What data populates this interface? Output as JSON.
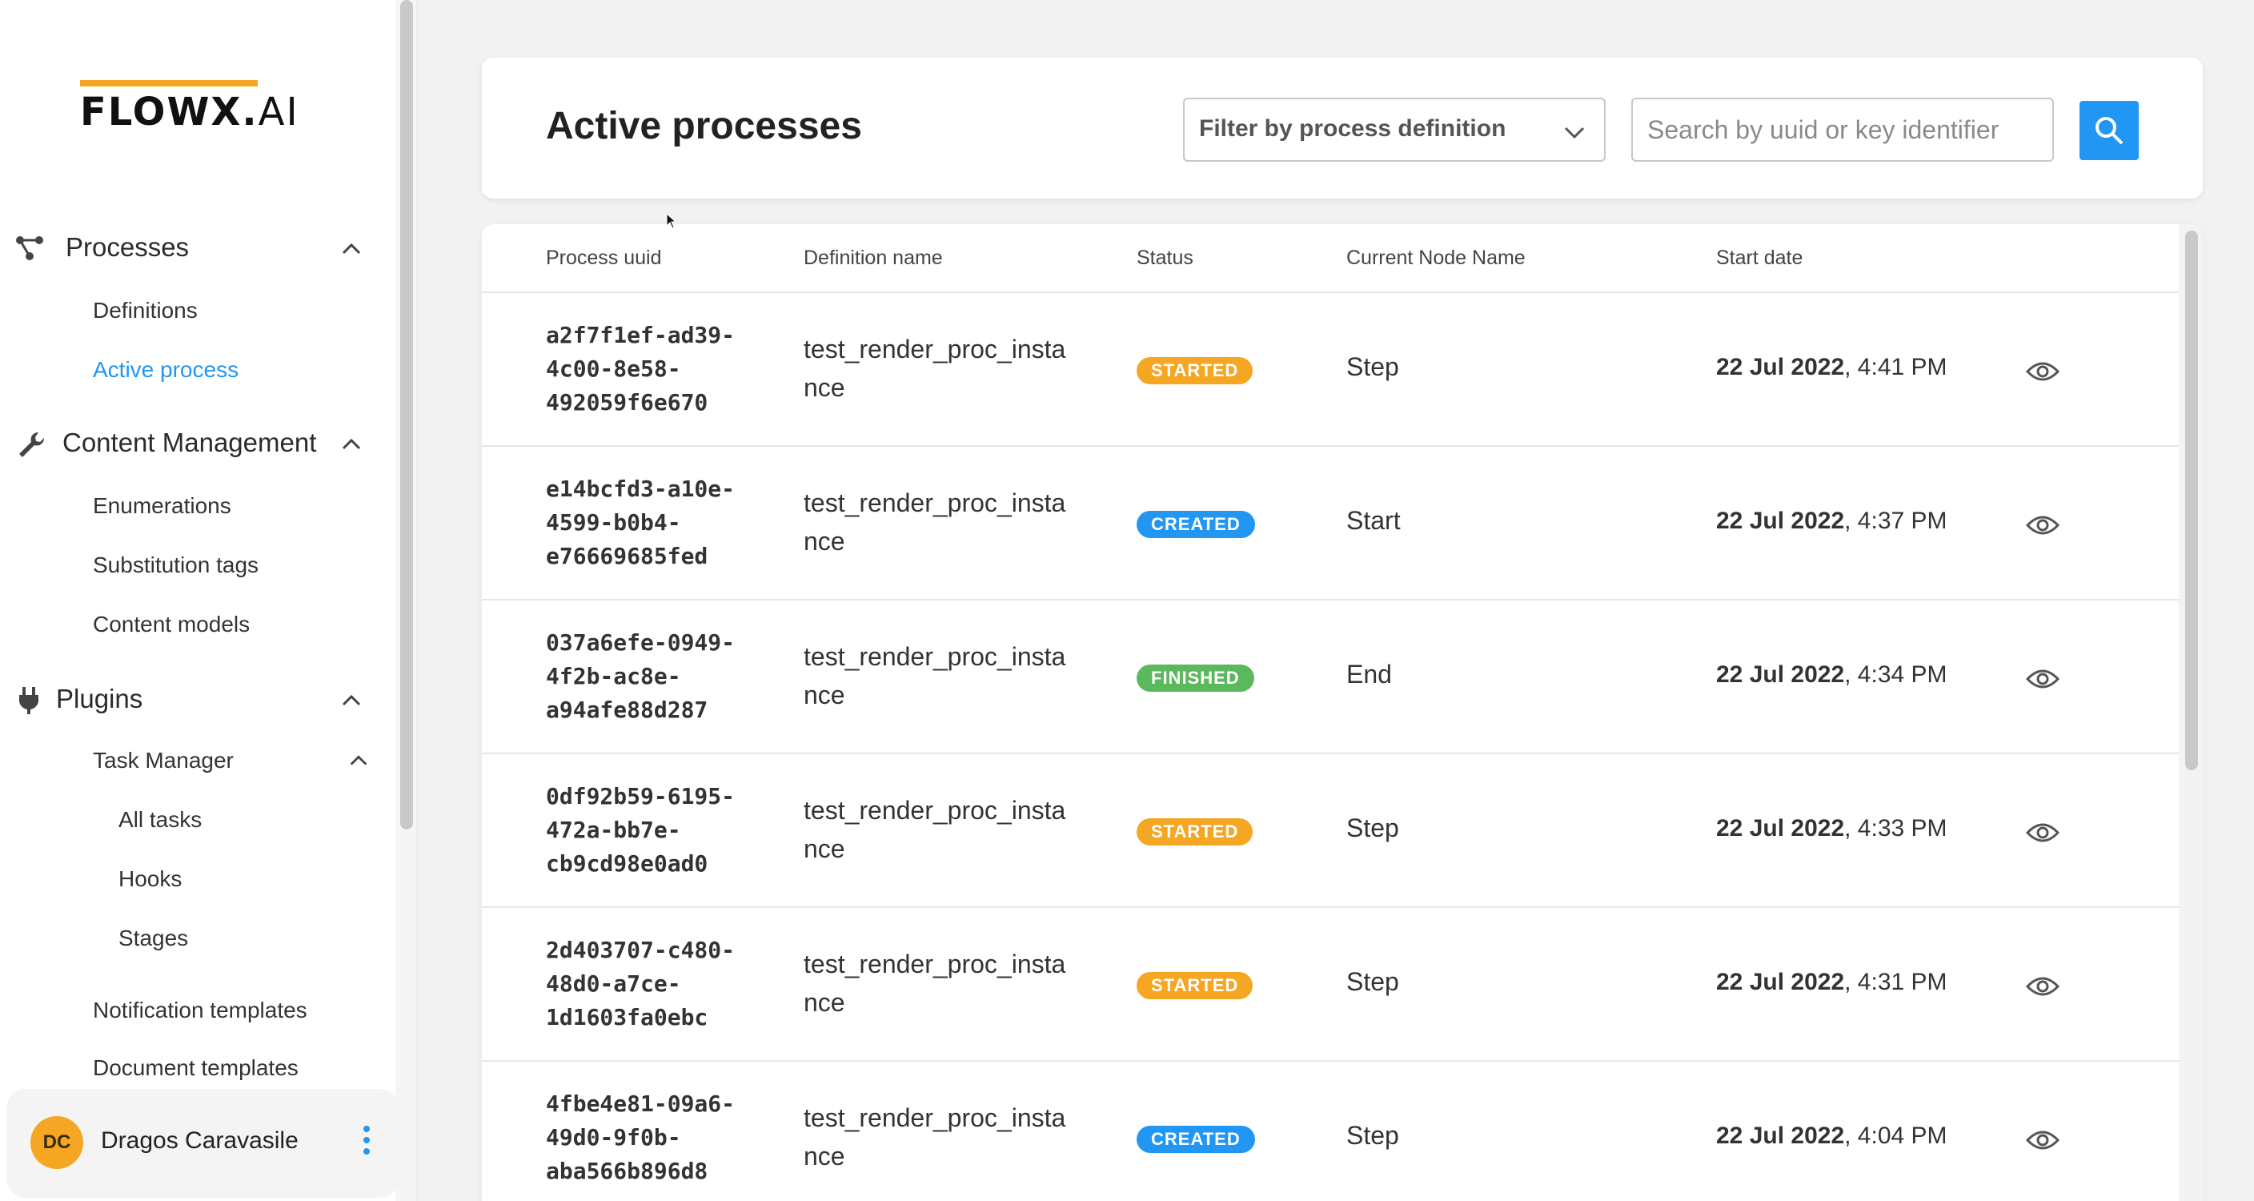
{
  "sidebar": {
    "logo_main": "FLOWX.",
    "logo_suffix": "AI",
    "colors": {
      "accent": "#2196f3",
      "brand": "#f5a623"
    },
    "groups": [
      {
        "label": "Processes",
        "icon": "process-icon"
      },
      {
        "label": "Content Management",
        "icon": "wrench-icon"
      },
      {
        "label": "Plugins",
        "icon": "plug-icon"
      }
    ],
    "items": {
      "definitions": "Definitions",
      "active_process": "Active process",
      "enumerations": "Enumerations",
      "substitution_tags": "Substitution tags",
      "content_models": "Content models",
      "task_manager": "Task Manager",
      "all_tasks": "All tasks",
      "hooks": "Hooks",
      "stages": "Stages",
      "notification_templates": "Notification templates",
      "document_templates": "Document templates"
    },
    "user": {
      "initials": "DC",
      "name": "Dragos Caravasile"
    }
  },
  "header": {
    "title": "Active processes",
    "filter_placeholder": "Filter by process definition",
    "search_placeholder": "Search by uuid or key identifier"
  },
  "table": {
    "columns": [
      "Process uuid",
      "Definition name",
      "Status",
      "Current Node Name",
      "Start date"
    ],
    "status_colors": {
      "STARTED": "#f5a623",
      "CREATED": "#2196f3",
      "FINISHED": "#5cb85c"
    },
    "rows": [
      {
        "uuid": "a2f7f1ef-ad39-4c00-8e58-492059f6e670",
        "definition": "test_render_proc_instance",
        "status": "STARTED",
        "node": "Step",
        "date": "22 Jul 2022",
        "time": ", 4:41 PM"
      },
      {
        "uuid": "e14bcfd3-a10e-4599-b0b4-e76669685fed",
        "definition": "test_render_proc_instance",
        "status": "CREATED",
        "node": "Start",
        "date": "22 Jul 2022",
        "time": ", 4:37 PM"
      },
      {
        "uuid": "037a6efe-0949-4f2b-ac8e-a94afe88d287",
        "definition": "test_render_proc_instance",
        "status": "FINISHED",
        "node": "End",
        "date": "22 Jul 2022",
        "time": ", 4:34 PM"
      },
      {
        "uuid": "0df92b59-6195-472a-bb7e-cb9cd98e0ad0",
        "definition": "test_render_proc_instance",
        "status": "STARTED",
        "node": "Step",
        "date": "22 Jul 2022",
        "time": ", 4:33 PM"
      },
      {
        "uuid": "2d403707-c480-48d0-a7ce-1d1603fa0ebc",
        "definition": "test_render_proc_instance",
        "status": "STARTED",
        "node": "Step",
        "date": "22 Jul 2022",
        "time": ", 4:31 PM"
      },
      {
        "uuid": "4fbe4e81-09a6-49d0-9f0b-aba566b896d8",
        "definition": "test_render_proc_instance",
        "status": "CREATED",
        "node": "Step",
        "date": "22 Jul 2022",
        "time": ", 4:04 PM"
      }
    ]
  }
}
